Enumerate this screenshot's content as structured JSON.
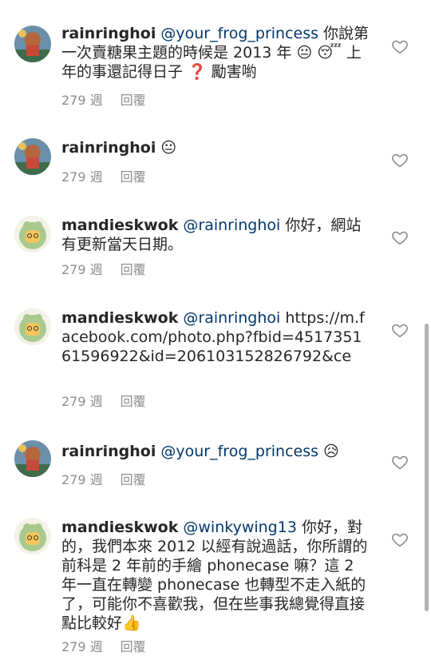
{
  "comments": [
    {
      "username": "rainringhoi",
      "mention": "@your_frog_princess",
      "body": " 你說第一次賣糖果主題的時候是 2013 年 😐 😴 上年的事還記得日子 ❓ 勵害喲",
      "time": "279 週",
      "reply": "回覆",
      "avatar": "rainringhoi-avatar"
    },
    {
      "username": "rainringhoi",
      "mention": "",
      "body": " 😐",
      "time": "279 週",
      "reply": "回覆",
      "avatar": "rainringhoi-avatar"
    },
    {
      "username": "mandieskwok",
      "mention": "@rainringhoi",
      "body": " 你好，網站有更新當天日期。",
      "time": "279 週",
      "reply": "回覆",
      "avatar": "mandieskwok-avatar"
    },
    {
      "username": "mandieskwok",
      "mention": "@rainringhoi",
      "body": " https://m.facebook.com/photo.php?fbid=451735161596922&id=206103152826792&ce",
      "time": "279 週",
      "reply": "回覆",
      "avatar": "mandieskwok-avatar"
    },
    {
      "username": "rainringhoi",
      "mention": "@your_frog_princess",
      "body": " 😥",
      "time": "279 週",
      "reply": "回覆",
      "avatar": "rainringhoi-avatar"
    },
    {
      "username": "mandieskwok",
      "mention": "@winkywing13",
      "body": " 你好，對的，我們本來 2012 以經有說過話，你所謂的前科是 2 年前的手繪 phonecase 嘛？這 2 年一直在轉變 phonecase 也轉型不走入紙的了，可能你不喜歡我，但在些事我總覺得直接點比較好👍",
      "time": "279 週",
      "reply": "回覆",
      "avatar": "mandieskwok-avatar"
    }
  ],
  "colors": {
    "username": "#262626",
    "mention": "#00376b",
    "meta": "#8e8e8e",
    "heart": "#8e8e8e"
  }
}
